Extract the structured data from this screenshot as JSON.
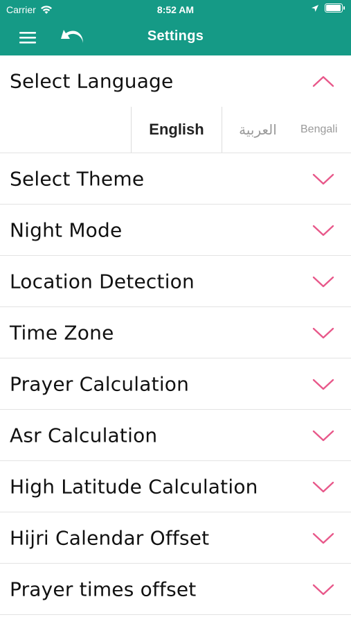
{
  "status_bar": {
    "carrier": "Carrier",
    "time": "8:52 AM"
  },
  "nav": {
    "title": "Settings"
  },
  "colors": {
    "header": "#159a86",
    "chevron": "#e8588a"
  },
  "language_section": {
    "label": "Select Language",
    "expanded": true,
    "options": [
      "English",
      "العربية",
      "Bengali"
    ],
    "selected": "English"
  },
  "settings": [
    {
      "label": "Select Theme"
    },
    {
      "label": "Night Mode"
    },
    {
      "label": "Location Detection"
    },
    {
      "label": "Time Zone"
    },
    {
      "label": "Prayer Calculation"
    },
    {
      "label": "Asr Calculation"
    },
    {
      "label": "High Latitude Calculation"
    },
    {
      "label": "Hijri Calendar Offset"
    },
    {
      "label": "Prayer times offset"
    }
  ]
}
